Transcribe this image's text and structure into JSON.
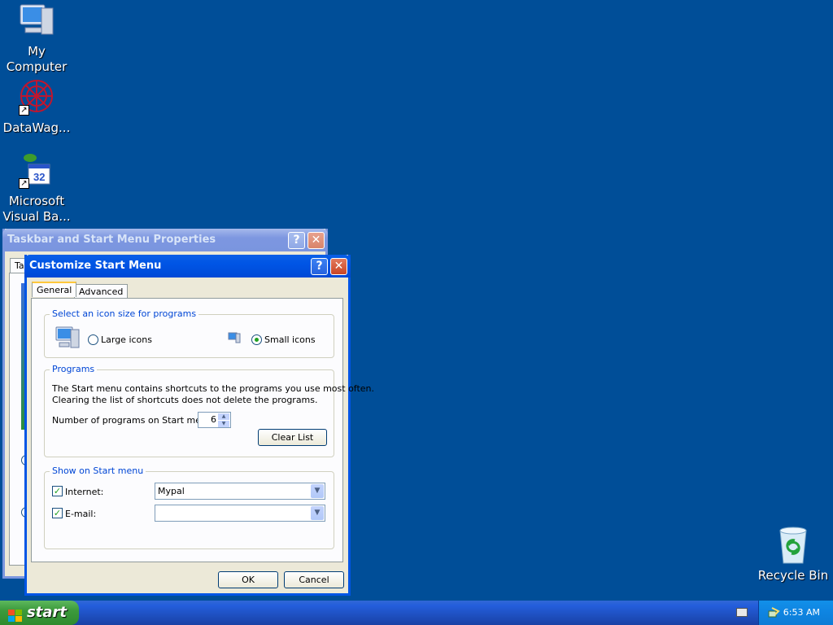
{
  "desktop": {
    "icons": [
      {
        "label_1": "My",
        "label_2": "Computer"
      },
      {
        "label_1": "DataWag...",
        "label_2": ""
      },
      {
        "label_1": "Microsoft",
        "label_2": "Visual Ba..."
      }
    ],
    "recycle_bin": "Recycle Bin"
  },
  "taskbar_props": {
    "title": "Taskbar and Start Menu Properties",
    "tab_partial": "Ta"
  },
  "customize": {
    "title": "Customize Start Menu",
    "tabs": [
      "General",
      "Advanced"
    ],
    "icon_size_group": "Select an icon size for programs",
    "large_icons": "Large icons",
    "small_icons": "Small icons",
    "selected_size": "small",
    "programs_group": "Programs",
    "programs_desc_1": "The Start menu contains shortcuts to the programs you use most often.",
    "programs_desc_2": "Clearing the list of shortcuts does not delete the programs.",
    "num_programs_label": "Number of programs on Start menu:",
    "num_programs_value": "6",
    "clear_list": "Clear List",
    "show_group": "Show on Start menu",
    "internet_label": "Internet:",
    "internet_value": "Mypal",
    "internet_checked": true,
    "email_label": "E-mail:",
    "email_value": "",
    "email_checked": true,
    "ok": "OK",
    "cancel": "Cancel"
  },
  "taskbar": {
    "start": "start",
    "time": "6:53 AM"
  },
  "colors": {
    "desktop": "#004e98",
    "title_active": "#0055e5",
    "title_inactive": "#7a96df"
  }
}
